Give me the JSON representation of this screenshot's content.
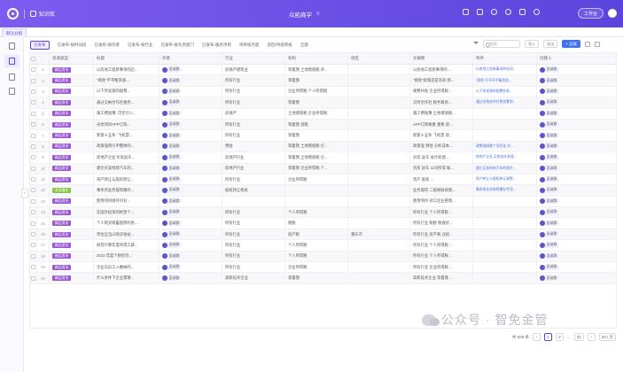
{
  "topbar": {
    "kb_name": "知识库",
    "center_title": "众拓商学",
    "workspace_button": "工作台"
  },
  "tabs": [
    {
      "label": "默认分组"
    }
  ],
  "views": [
    {
      "label": "已发布",
      "active": true
    },
    {
      "label": "已发布-按时间段",
      "active": false
    },
    {
      "label": "已发布-按作者",
      "active": false
    },
    {
      "label": "已发布-按行业",
      "active": false
    },
    {
      "label": "已发布-按负责部门",
      "active": false
    },
    {
      "label": "已发布-服务项目",
      "active": false
    },
    {
      "label": "待审核内容",
      "active": false
    },
    {
      "label": "驳回/待提审核",
      "active": false
    },
    {
      "label": "全部",
      "active": false
    }
  ],
  "toolbar": {
    "search_placeholder": "搜索",
    "import_label": "导入",
    "export_label": "导出",
    "new_label": "+ 记录"
  },
  "table": {
    "columns": [
      "资源类型",
      "标题",
      "作者",
      "行业",
      "机构",
      "地区",
      "文摘要",
      "附件",
      "创建人"
    ],
    "rows": [
      {
        "idx": "1",
        "type": "精品资讯",
        "type_color": "#9b59d0",
        "title": "以房地工程新事项的启...",
        "author": "彭淑群",
        "industry": "房地产建筑业",
        "org": "等着我 土地增值税 开...",
        "region": "",
        "summary": "以房地工程新事项的 ...",
        "attach": "以房地工程新事项的启动...",
        "creator": "彭淑群"
      },
      {
        "idx": "2",
        "type": "精品资讯",
        "type_color": "#9b59d0",
        "title": "\"两免\"不平衡资质...",
        "author": "彭淑群",
        "industry": "所有行业",
        "org": "等着我",
        "region": "",
        "summary": "\"两免\"政策还是有效 新...",
        "attach": "\"两免\"不平不平衡资质...",
        "creator": "彭淑群"
      },
      {
        "idx": "3",
        "type": "精品资讯",
        "type_color": "#9b59d0",
        "title": "以下所发源的规费...",
        "author": "彭淑群",
        "industry": "所有行业",
        "org": "企业所得税 个人所得税",
        "region": "",
        "summary": "规费补贴 企业所得税 ...",
        "attach": "以下所发源的规费补贴...",
        "creator": "彭淑群"
      },
      {
        "idx": "4",
        "type": "精品资讯",
        "type_color": "#9b59d0",
        "title": "通过交纳合作社税务...",
        "author": "彭淑群",
        "industry": "所有行业",
        "org": "等着我",
        "region": "",
        "summary": "交所合作社 税务筹划 ...",
        "attach": "通过交纳合作社税务筹划...",
        "creator": "彭淑群"
      },
      {
        "idx": "5",
        "type": "精品资讯",
        "type_color": "#9b59d0",
        "title": "施工费账簿: 可否计入...",
        "author": "彭淑群",
        "industry": "房地产",
        "org": "土地增值税 企业所得税",
        "region": "",
        "summary": "施工费账簿 土地增值税...",
        "attach": "",
        "creator": "彭淑群"
      },
      {
        "idx": "6",
        "type": "精品资讯",
        "type_color": "#9b59d0",
        "title": "光伏项目APP订购...",
        "author": "彭淑群",
        "industry": "所有行业",
        "org": "等着我 退税",
        "region": "",
        "summary": "APP订购要素 重要 退...",
        "attach": "",
        "creator": "彭淑群"
      },
      {
        "idx": "7",
        "type": "精品资讯",
        "type_color": "#9b59d0",
        "title": "新第十五条: 飞机票...",
        "author": "彭淑群",
        "industry": "所有行业",
        "org": "等着我",
        "region": "",
        "summary": "新第十五条 飞机票 退...",
        "attach": "",
        "creator": "彭淑群"
      },
      {
        "idx": "8",
        "type": "精品资讯",
        "type_color": "#9b59d0",
        "title": "政策强制引申整体的...",
        "author": "彭淑群",
        "industry": "预估",
        "org": "等着我 土地增值税 企...",
        "region": "",
        "summary": "政策强 预估 分析成本...",
        "attach": "政策强制整个项目化 关...",
        "creator": "彭淑群"
      },
      {
        "idx": "9",
        "type": "精品资讯",
        "type_color": "#9b59d0",
        "title": "房地产企业'买房送车...",
        "author": "彭淑群",
        "industry": "房地产行业",
        "org": "等着我 土地增值税 企...",
        "region": "",
        "summary": "买房 送车 会计处理 ...",
        "attach": "房地产企业 买房送车处理...",
        "creator": "彭淑群"
      },
      {
        "idx": "10",
        "type": "精品资讯",
        "type_color": "#9b59d0",
        "title": "建企买卖给新汽车的...",
        "author": "彭淑群",
        "industry": "房地产行业",
        "org": "等着我 企业所得税 个...",
        "region": "",
        "summary": "买房 送车 公司所得 联...",
        "attach": "建企买卖给新汽车的相关...",
        "creator": "彭淑群"
      },
      {
        "idx": "11",
        "type": "精品资讯",
        "type_color": "#9b59d0",
        "title": "资产转让与股权转让...",
        "author": "彭淑群",
        "industry": "所有行业",
        "org": "企业所得税",
        "region": "",
        "summary": "资产 股权 ...",
        "attach": "资产转让与股权转让政策...",
        "creator": "彭淑群"
      },
      {
        "idx": "12",
        "type": "实务操作",
        "type_color": "#8bc34a",
        "title": "事务所业务取得缴存...",
        "author": "彭淑群",
        "industry": "股权转让相关",
        "org": "",
        "region": "",
        "summary": "业务取得 二级税收政策...",
        "attach": "事务所业务取得缴存专项...",
        "creator": "彭淑群"
      },
      {
        "idx": "13",
        "type": "精品资讯",
        "type_color": "#9b59d0",
        "title": "使用项目接待对对...",
        "author": "彭淑群",
        "industry": "",
        "org": "",
        "region": "",
        "summary": "使用项目 对口企业管理...",
        "attach": "",
        "creator": "彭淑群"
      },
      {
        "idx": "14",
        "type": "精品资讯",
        "type_color": "#9b59d0",
        "title": "在国外投资的经营个...",
        "author": "彭淑群",
        "industry": "所有行业",
        "org": "个人所得税",
        "region": "",
        "summary": "所有行业 个人所得税 ...",
        "attach": "",
        "creator": "彭淑群"
      },
      {
        "idx": "15",
        "type": "精品资讯",
        "type_color": "#9b59d0",
        "title": "个人购买储蓄国债利息...",
        "author": "彭淑群",
        "industry": "所有行业",
        "org": "税税",
        "region": "",
        "summary": "所有行业 税税 税收优...",
        "attach": "",
        "creator": "彭淑群"
      },
      {
        "idx": "16",
        "type": "精品资讯",
        "type_color": "#9b59d0",
        "title": "单位应当以购买收益...",
        "author": "彭淑群",
        "industry": "所有行业",
        "org": "房产税",
        "region": "重庆市",
        "summary": "所有行业 房产税 过程...",
        "attach": "",
        "creator": "彭淑群"
      },
      {
        "idx": "17",
        "type": "精品资讯",
        "type_color": "#9b59d0",
        "title": "如何计算年度所得工薪...",
        "author": "彭淑群",
        "industry": "所有行业",
        "org": "个人所得税",
        "region": "",
        "summary": "所有行业 个人所得税 ...",
        "attach": "",
        "creator": "彭淑群"
      },
      {
        "idx": "18",
        "type": "精品资讯",
        "type_color": "#9b59d0",
        "title": "2023 年度个税综合...",
        "author": "彭淑群",
        "industry": "所有行业",
        "org": "个人所得税",
        "region": "",
        "summary": "所有行业 个人所得税 ...",
        "attach": "",
        "creator": "彭淑群"
      },
      {
        "idx": "19",
        "type": "精品资讯",
        "type_color": "#9b59d0",
        "title": "企业向员工入缴纳的...",
        "author": "彭淑群",
        "industry": "所有行业",
        "org": "企业所得税",
        "region": "",
        "summary": "所有行业 企业所得税 ...",
        "attach": "",
        "creator": "彭淑群"
      },
      {
        "idx": "20",
        "type": "精品资讯",
        "type_color": "#9b59d0",
        "title": "什么条件下企业需要...",
        "author": "彭淑群",
        "industry": "高新技术企业",
        "org": "等着我",
        "region": "",
        "summary": "高新技术企业 等着我 ...",
        "attach": "",
        "creator": "彭淑群"
      }
    ]
  },
  "pagination": {
    "total": "共 609 条",
    "pages": [
      "1",
      "2",
      "...",
      "31"
    ],
    "page_size": "20 / 页"
  },
  "watermark": {
    "text": "公众号 · 智免金管"
  }
}
